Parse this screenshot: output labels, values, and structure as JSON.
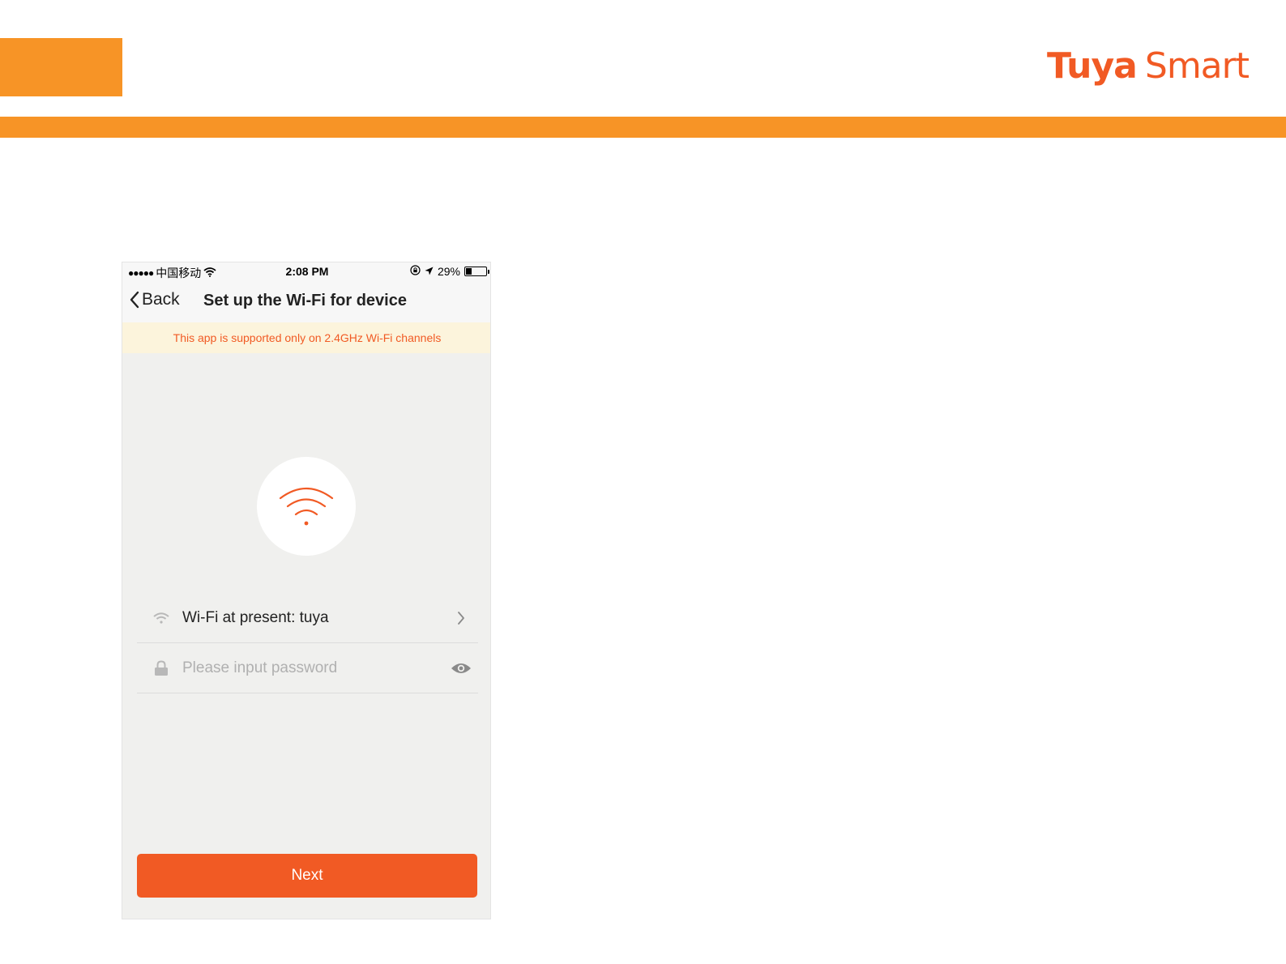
{
  "brand": {
    "part1": "Tuya",
    "part2": "Smart",
    "color": "#f15a24"
  },
  "accent_color": "#f79426",
  "status_bar": {
    "signal": "●●●●●",
    "carrier": "中国移动",
    "time": "2:08 PM",
    "battery": "29%",
    "battery_level": 0.29
  },
  "nav": {
    "back_label": "Back",
    "title": "Set up the Wi-Fi for device"
  },
  "notice": "This app is supported only on 2.4GHz Wi-Fi channels",
  "wifi_row": {
    "label": "Wi-Fi at present: tuya"
  },
  "password_row": {
    "placeholder": "Please input password",
    "value": ""
  },
  "next_button": {
    "label": "Next",
    "color": "#f15a24"
  },
  "icons": [
    "wifi-icon",
    "chevron-left-icon",
    "chevron-right-icon",
    "lock-icon",
    "eye-icon",
    "orientation-lock-icon",
    "location-arrow-icon",
    "battery-icon"
  ]
}
